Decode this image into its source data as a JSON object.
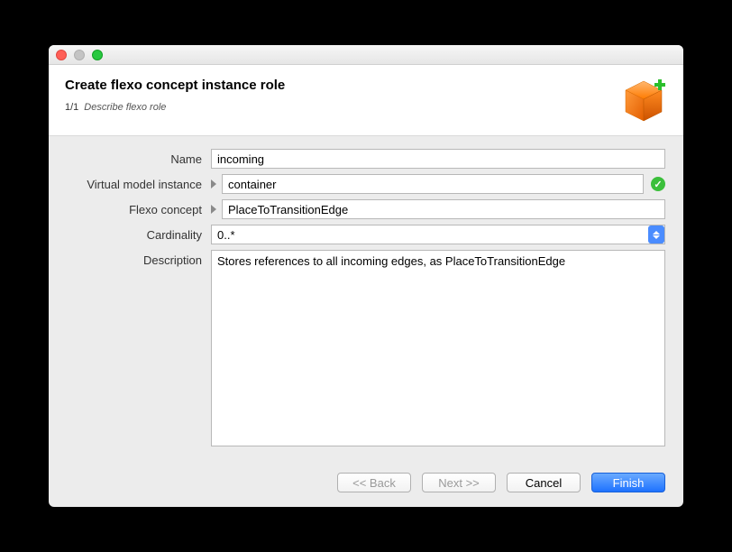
{
  "header": {
    "title": "Create flexo concept instance role",
    "step": "1/1",
    "stepDesc": "Describe flexo role"
  },
  "form": {
    "name": {
      "label": "Name",
      "value": "incoming"
    },
    "vmi": {
      "label": "Virtual model instance",
      "value": "container"
    },
    "concept": {
      "label": "Flexo concept",
      "value": "PlaceToTransitionEdge"
    },
    "cardinality": {
      "label": "Cardinality",
      "value": "0..*"
    },
    "description": {
      "label": "Description",
      "value": "Stores references to all incoming edges, as PlaceToTransitionEdge"
    }
  },
  "buttons": {
    "back": "<< Back",
    "next": "Next >>",
    "cancel": "Cancel",
    "finish": "Finish"
  }
}
